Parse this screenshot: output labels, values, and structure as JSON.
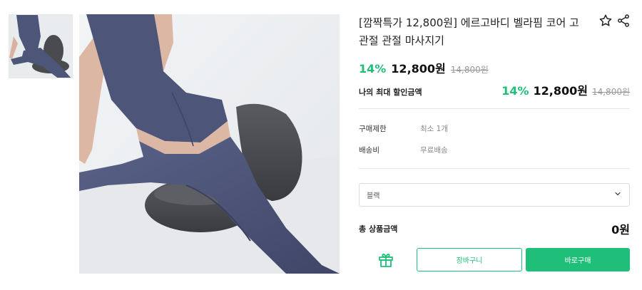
{
  "product": {
    "title": "[깜짝특가 12,800원] 에르고바디 벨라핌 코어 고관절 관절 마사지기",
    "discount_pct": "14%",
    "price": "12,800원",
    "original_price": "14,800원"
  },
  "max_discount": {
    "label": "나의 최대 할인금액",
    "pct": "14%",
    "price": "12,800원",
    "original_price": "14,800원"
  },
  "info": [
    {
      "label": "구매제한",
      "value": "최소 1개"
    },
    {
      "label": "배송비",
      "value": "무료배송"
    }
  ],
  "option_select": {
    "value": "블랙"
  },
  "total": {
    "label": "총 상품금액",
    "value": "0원"
  },
  "buttons": {
    "cart": "장바구니",
    "buy": "바로구매"
  },
  "icons": [
    "star-outline-icon",
    "share-icon",
    "gift-icon",
    "chevron-down-icon"
  ],
  "colors": {
    "accent": "#1fbf7a",
    "leggings": "#4d5578",
    "cushion": "#4a4b4f"
  }
}
